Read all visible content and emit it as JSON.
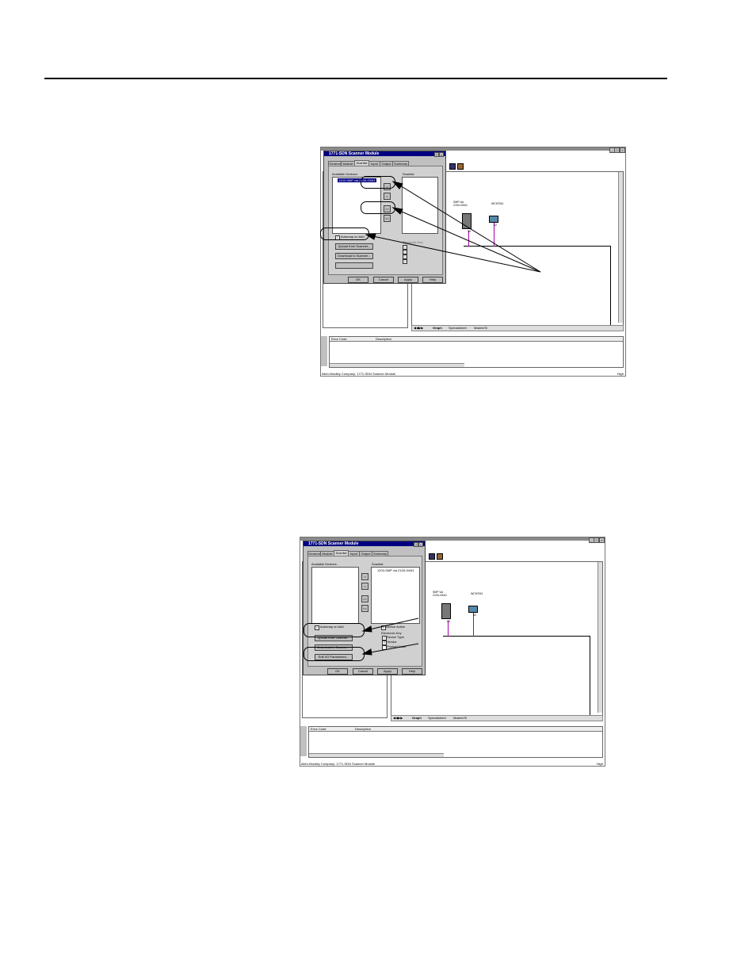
{
  "shot1": {
    "dialog_title": "1771-SDN Scanner Module",
    "tabs": [
      "General",
      "Module",
      "Scanlist",
      "Input",
      "Output",
      "Summary"
    ],
    "available_devices_label": "Available Devices:",
    "scanlist_label": "Scanlist:",
    "available_item": "1203-SMP via 2100-GK61",
    "automap_label": "Automap on Add",
    "upload_button": "Upload from Scanner...",
    "download_button": "Download to Scanner...",
    "electronic_key_label": "Electronic Key",
    "ok": "OK",
    "cancel": "Cancel",
    "apply": "Apply",
    "help": "Help",
    "device1_label": "SMP via\n2100-GK61",
    "device1_addr": "05",
    "device2_label": "WCNTM1",
    "device2_addr": "62",
    "sheet_tabs": [
      "Graph",
      "Spreadsheet",
      "Master/Sl"
    ],
    "msg_col1": "Error Code",
    "msg_col2": "Description",
    "status_left": "Allen-Bradley Company: 1771-SDN Scanner Module",
    "status_right": "High"
  },
  "shot2": {
    "dialog_title": "1771-SDN Scanner Module",
    "tabs": [
      "General",
      "Module",
      "Scanlist",
      "Input",
      "Output",
      "Summary"
    ],
    "available_devices_label": "Available Devices:",
    "scanlist_label": "Scanlist:",
    "scanlist_item": "1203-SMP via 2100-GK61",
    "automap_label": "Automap on Add",
    "upload_button": "Upload from Scanner...",
    "download_button": "Download to Scanner...",
    "edit_io_button": "Edit I/O Parameters...",
    "device_active_label": "Device Active",
    "electronic_key_label": "Electronic Key",
    "device_type": "Device Type",
    "vendor": "Vendor",
    "product_code": "Product Code",
    "ok": "OK",
    "cancel": "Cancel",
    "apply": "Apply",
    "help": "Help",
    "device1_label": "SMP via\n2100-GK61",
    "device1_addr": "05",
    "device2_label": "WCNTM1",
    "device2_addr": "62",
    "sheet_tabs": [
      "Graph",
      "Spreadsheet",
      "Master/Sl"
    ],
    "msg_col1": "Error Code",
    "msg_col2": "Description",
    "status_left": "Allen-Bradley Company: 1771-SDN Scanner Module",
    "status_right": "High"
  }
}
